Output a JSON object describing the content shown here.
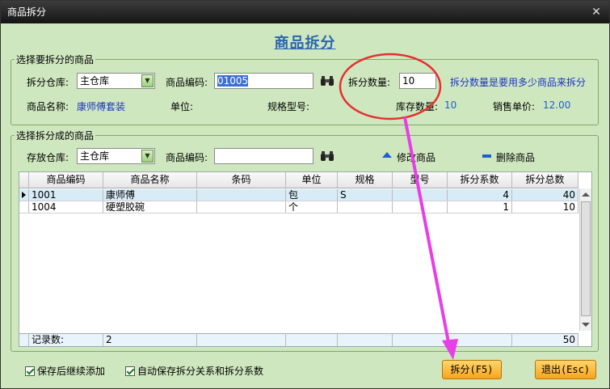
{
  "window": {
    "title": "商品拆分",
    "close": "✕"
  },
  "heading": "商品拆分",
  "source": {
    "legend": "选择要拆分的商品",
    "warehouse_label": "拆分仓库:",
    "warehouse_value": "主仓库",
    "code_label": "商品编码:",
    "code_value": "01005",
    "qty_label": "拆分数量:",
    "qty_value": "10",
    "qty_hint": "拆分数量是要用多少商品来拆分",
    "name_label": "商品名称:",
    "name_value": "康师傅套装",
    "unit_label": "单位:",
    "spec_label": "规格型号:",
    "stock_label": "库存数量:",
    "stock_value": "10",
    "price_label": "销售单价:",
    "price_value": "12.00"
  },
  "target": {
    "legend": "选择拆分成的商品",
    "warehouse_label": "存放仓库:",
    "warehouse_value": "主仓库",
    "code_label": "商品编码:",
    "code_value": "",
    "edit_label": "修改商品",
    "delete_label": "删除商品"
  },
  "table": {
    "columns": [
      "商品编码",
      "商品名称",
      "条码",
      "单位",
      "规格",
      "型号",
      "拆分系数",
      "拆分总数"
    ],
    "rows": [
      [
        "1001",
        "康师傅",
        "",
        "包",
        "S",
        "",
        "4",
        "40"
      ],
      [
        "1004",
        "硬塑胶碗",
        "",
        "个",
        "",
        "",
        "1",
        "10"
      ]
    ],
    "footer": {
      "label": "记录数:",
      "count": "2",
      "total": "50"
    }
  },
  "options": {
    "keep_adding": "保存后继续添加",
    "auto_save": "自动保存拆分关系和拆分系数"
  },
  "buttons": {
    "split": "拆分(F5)",
    "exit": "退出(Esc)"
  },
  "colors": {
    "accent_blue": "#1c34c8",
    "button_orange": "#f7a51c",
    "annotation_red": "#e53030",
    "annotation_magenta": "#e83ee8"
  }
}
